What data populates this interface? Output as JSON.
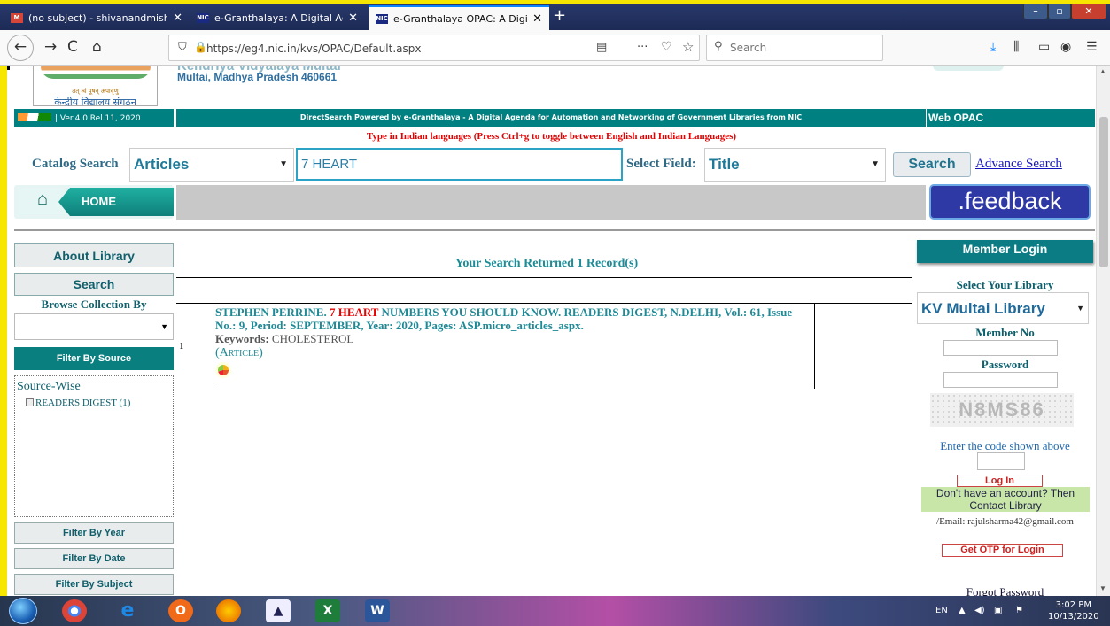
{
  "browser": {
    "tabs": [
      {
        "label": "(no subject) - shivanandmishra",
        "favicon": "M"
      },
      {
        "label": "e-Granthalaya: A Digital Agend",
        "favicon": "NIC"
      },
      {
        "label": "e-Granthalaya OPAC: A Digital",
        "favicon": "NIC"
      }
    ],
    "url": "https://eg4.nic.in/kvs/OPAC/Default.aspx",
    "search_placeholder": "Search"
  },
  "header": {
    "org_name": "Kendriya Vidyalaya Multai",
    "org_address": "Multai, Madhya Pradesh 460661",
    "motto": "तत् त्वं पूषन् अपावृणु",
    "sangathan": "केन्द्रीय विद्यालय संगठन",
    "version": "| Ver.4.0 Rel.11, 2020",
    "powered_by": "DirectSearch Powered by e-Granthalaya - A Digital Agenda for Automation and Networking of Government Libraries from NIC",
    "web_opac": "Web OPAC",
    "language_note": "Type in Indian languages (Press Ctrl+g to toggle between English and Indian Languages)"
  },
  "search": {
    "catalog_label": "Catalog Search",
    "catalog_value": "Articles",
    "query": "7 HEART",
    "field_label": "Select Field:",
    "field_value": "Title",
    "button": "Search",
    "advanced": "Advance Search"
  },
  "nav": {
    "home": "HOME",
    "feedback": ".feedback"
  },
  "left": {
    "about": "About Library",
    "search": "Search",
    "browse_label": "Browse Collection By",
    "filter_source": "Filter By Source",
    "source_heading": "Source-Wise",
    "source_item": "READERS DIGEST (1)",
    "filter_year": "Filter By Year",
    "filter_date": "Filter By Date",
    "filter_subject": "Filter By Subject"
  },
  "results": {
    "summary": "Your Search Returned 1 Record(s)",
    "rows": [
      {
        "num": "1",
        "author": "STEPHEN PERRINE. ",
        "highlight": "7 HEART",
        "rest": " NUMBERS YOU SHOULD KNOW. READERS DIGEST, N.DELHI, Vol.: 61, Issue No.: 9, Period: SEPTEMBER, Year: 2020, Pages: ASP.micro_articles_aspx.",
        "keywords_label": "Keywords:",
        "keywords": " CHOLESTEROL",
        "type": "(Article)"
      }
    ]
  },
  "login": {
    "title": "Member Login",
    "select_library": "Select Your Library",
    "library": "KV Multai Library",
    "member_no": "Member No",
    "password": "Password",
    "captcha": "N8MS86",
    "code_prompt": "Enter the code shown above",
    "login_btn": "Log In",
    "account_note": "Don't have an account? Then Contact Library",
    "email": "/Email: rajulsharma42@gmail.com",
    "otp": "Get OTP for Login",
    "forgot": "Forgot Password"
  },
  "taskbar": {
    "lang": "EN",
    "time": "3:02 PM",
    "date": "10/13/2020"
  }
}
